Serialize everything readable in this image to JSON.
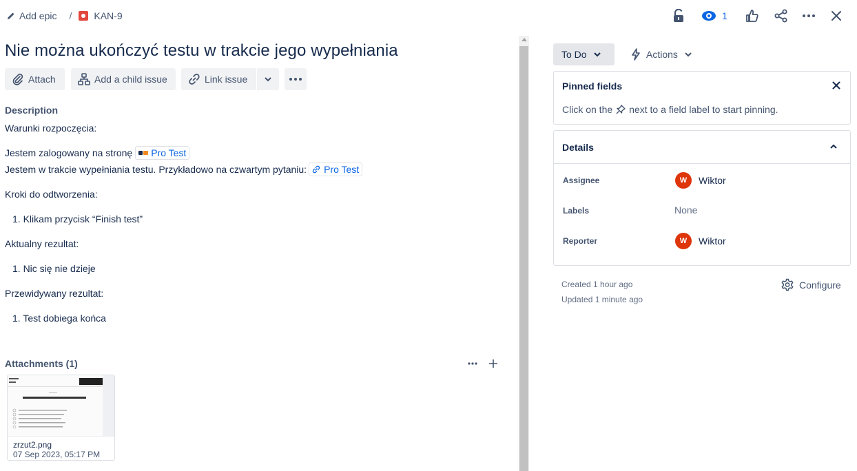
{
  "breadcrumb": {
    "add_epic": "Add epic",
    "separator": "/",
    "issue_key": "KAN-9"
  },
  "toolbar": {
    "watch_count": "1"
  },
  "issue": {
    "title": "Nie można ukończyć testu w trakcie jego wypełniania"
  },
  "actions": {
    "attach": "Attach",
    "add_child": "Add a child issue",
    "link_issue": "Link issue"
  },
  "description": {
    "heading": "Description",
    "line1": "Warunki rozpoczęcia:",
    "line2_prefix": "Jestem zalogowany na stronę",
    "line2_link": "Pro Test",
    "line3_prefix": "Jestem w trakcie wypełniania testu. Przykładowo na czwartym pytaniu:",
    "line3_link": "Pro Test",
    "steps_heading": "Kroki do odtworzenia:",
    "step1": "1. Klikam przycisk “Finish test”",
    "actual_heading": "Aktualny rezultat:",
    "actual1": "1. Nic się nie dzieje",
    "expected_heading": "Przewidywany rezultat:",
    "expected1": "1. Test dobiega końca"
  },
  "attachments": {
    "heading": "Attachments (1)",
    "file_name": "zrzut2.png",
    "file_date": "07 Sep 2023, 05:17 PM"
  },
  "status": {
    "label": "To Do",
    "actions_label": "Actions"
  },
  "pinned": {
    "title": "Pinned fields",
    "hint_before": "Click on the",
    "hint_after": "next to a field label to start pinning."
  },
  "details": {
    "title": "Details",
    "assignee_label": "Assignee",
    "assignee_name": "Wiktor",
    "assignee_initial": "W",
    "labels_label": "Labels",
    "labels_value": "None",
    "reporter_label": "Reporter",
    "reporter_name": "Wiktor",
    "reporter_initial": "W"
  },
  "footer": {
    "created": "Created 1 hour ago",
    "updated": "Updated 1 minute ago",
    "configure": "Configure"
  },
  "colors": {
    "accent": "#0c66e4",
    "avatar": "#de350b",
    "issue_type": "#e2483d"
  }
}
